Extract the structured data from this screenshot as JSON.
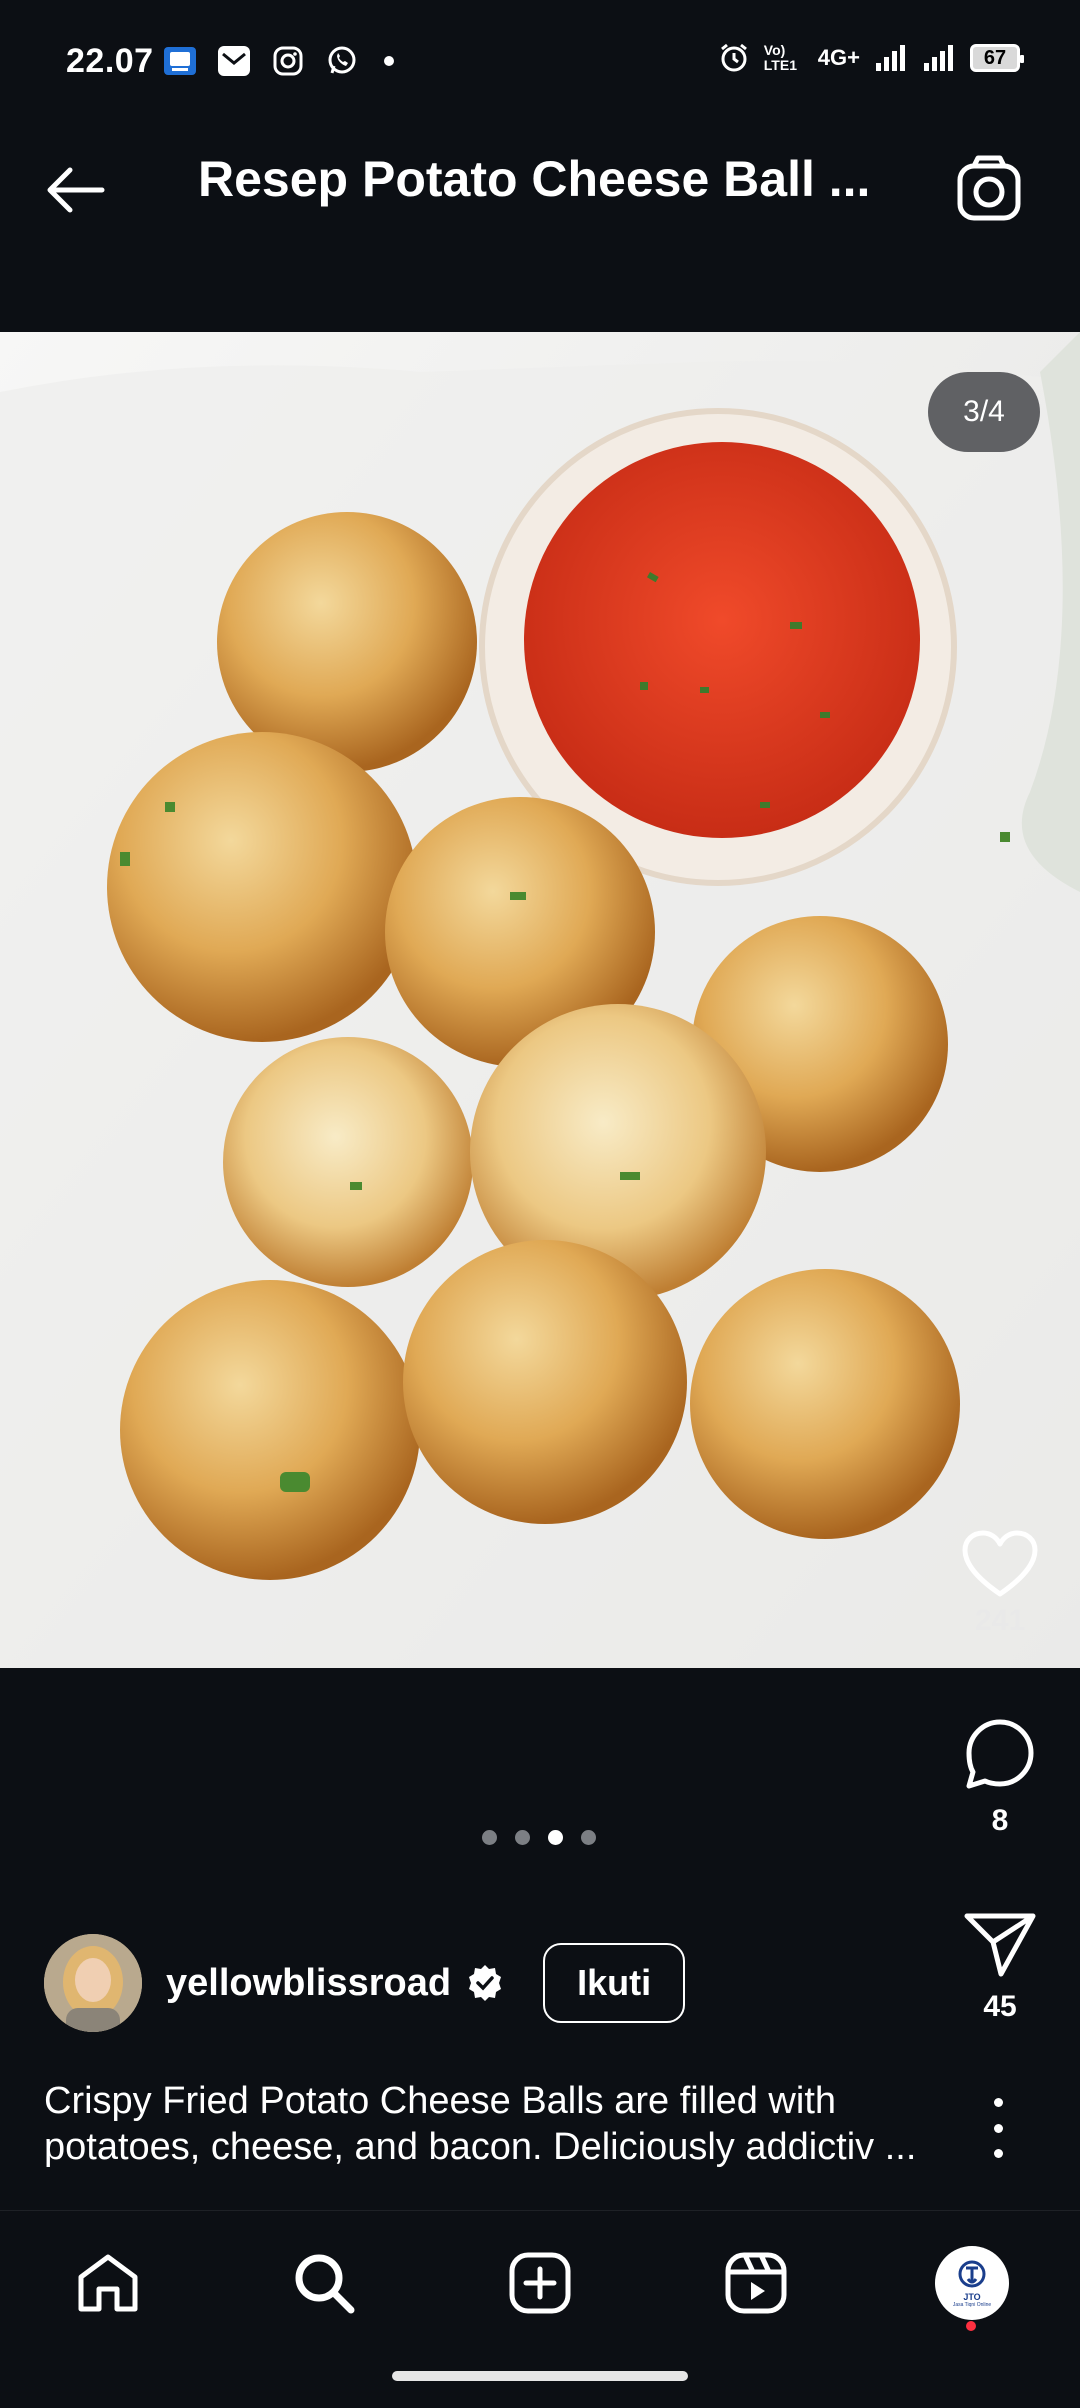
{
  "status_bar": {
    "time": "22.07",
    "network": "4G+",
    "volte": "Vo) LTE1",
    "battery": "67"
  },
  "header": {
    "title": "Resep Potato Cheese Ball ..."
  },
  "post": {
    "image_counter": "3/4",
    "carousel": {
      "total": 4,
      "active_index": 2
    },
    "likes": "241",
    "comments": "8",
    "shares": "45",
    "author": "yellowblissroad",
    "follow_label": "Ikuti",
    "caption": "Crispy Fried Potato Cheese Balls are filled with potatoes, cheese, and bacon. Deliciously addictiv ..."
  },
  "profile_badge": {
    "line1": "JTO",
    "line2": "Jasa Tiqni Online"
  },
  "colors": {
    "background": "#0c0f14",
    "notification": "#ff3040"
  }
}
